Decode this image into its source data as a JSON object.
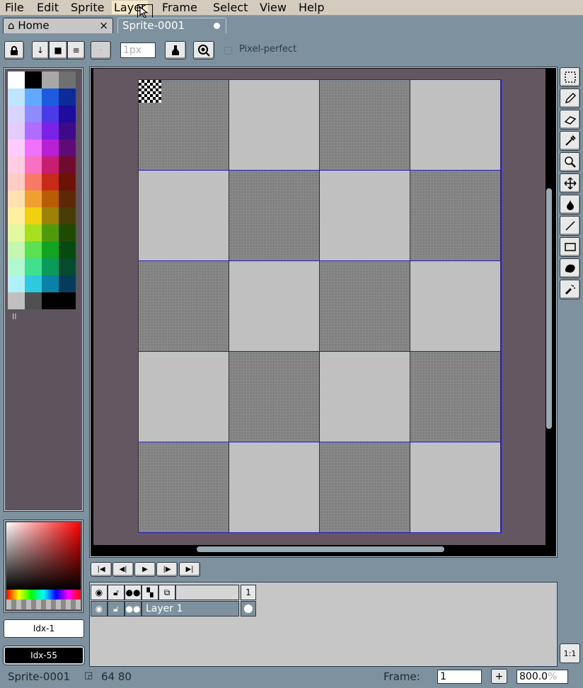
{
  "menu": [
    "File",
    "Edit",
    "Sprite",
    "Layer",
    "Frame",
    "Select",
    "View",
    "Help"
  ],
  "menu_active": "Layer",
  "tabs": {
    "home": {
      "label": "Home",
      "close": "×"
    },
    "sprite": {
      "label": "Sprite-0001"
    }
  },
  "toolbar": {
    "brush_size_placeholder": "1px",
    "pixel_perfect_label": "Pixel-perfect"
  },
  "palette": {
    "colors": [
      "#ffffff",
      "#000000",
      "#a8a8a8",
      "#707070",
      "#bfe4ff",
      "#62a8ff",
      "#1e5ae0",
      "#0c2a98",
      "#d7d4ff",
      "#8e8aff",
      "#4a3ae8",
      "#1e0c9e",
      "#e4ccff",
      "#b06cff",
      "#7c22e8",
      "#3d0a8a",
      "#ffccff",
      "#f070ff",
      "#b820d8",
      "#600a78",
      "#ffcce4",
      "#f870c0",
      "#c81e72",
      "#700a2e",
      "#ffccc4",
      "#f87a66",
      "#c82a18",
      "#6c1206",
      "#ffe0b0",
      "#f0a030",
      "#b85c06",
      "#5e2804",
      "#fff0a0",
      "#f0d010",
      "#9e8208",
      "#4a3c06",
      "#e4f8a0",
      "#a8e020",
      "#4e9a0a",
      "#204a04",
      "#c4f8b0",
      "#5ae050",
      "#10a420",
      "#064a10",
      "#b0f8d0",
      "#40e090",
      "#0a9a5a",
      "#064a30",
      "#b0f0f8",
      "#30c8e0",
      "#0a82a8",
      "#063c5a",
      "#c0c0c0",
      "#505050",
      "#000000",
      "#000000"
    ],
    "handle": "II"
  },
  "color_indices": {
    "foreground": "Idx-1",
    "background": "Idx-55"
  },
  "animation_controls": [
    "first-frame",
    "previous-frame",
    "play",
    "next-frame",
    "last-frame"
  ],
  "timeline": {
    "frame_number": "1",
    "layer_name": "Layer 1"
  },
  "zoom_button": "1:1",
  "status": {
    "sprite_name": "Sprite-0001",
    "size": "64 80",
    "frame_label": "Frame:",
    "frame_value": "1",
    "plus": "+",
    "zoom_value": "800.0",
    "zoom_unit": "%"
  }
}
